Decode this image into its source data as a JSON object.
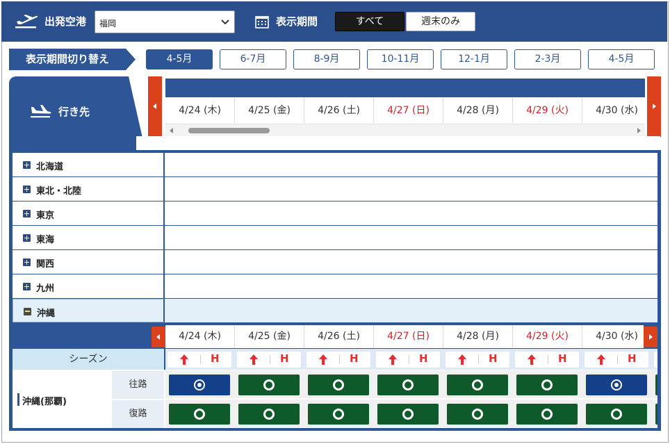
{
  "header": {
    "departure_label": "出発空港",
    "departure_airport": "福岡",
    "display_period_label": "表示期間",
    "filter_all": "すべて",
    "filter_weekend": "週末のみ"
  },
  "period_switch": {
    "label": "表示期間切り替え",
    "options": [
      "4-5月",
      "6-7月",
      "8-9月",
      "10-11月",
      "12-1月",
      "2-3月",
      "4-5月"
    ],
    "active_index": 0
  },
  "destinations_label": "行き先",
  "dates": [
    {
      "label": "4/24 (木)",
      "holiday": false
    },
    {
      "label": "4/25 (金)",
      "holiday": false
    },
    {
      "label": "4/26 (土)",
      "holiday": false
    },
    {
      "label": "4/27 (日)",
      "holiday": true
    },
    {
      "label": "4/28 (月)",
      "holiday": false
    },
    {
      "label": "4/29 (火)",
      "holiday": true
    },
    {
      "label": "4/30 (水)",
      "holiday": false
    }
  ],
  "regions": [
    {
      "name": "北海道",
      "expanded": false
    },
    {
      "name": "東北・北陸",
      "expanded": false
    },
    {
      "name": "東京",
      "expanded": false
    },
    {
      "name": "東海",
      "expanded": false
    },
    {
      "name": "関西",
      "expanded": false
    },
    {
      "name": "九州",
      "expanded": false
    },
    {
      "name": "沖縄",
      "expanded": true
    }
  ],
  "season_label": "シーズン",
  "season_mark": "H",
  "route": {
    "name": "沖縄(那覇)",
    "outbound_label": "往路",
    "return_label": "復路",
    "outbound": [
      "blue",
      "green",
      "green",
      "green",
      "green",
      "green",
      "blue"
    ],
    "return": [
      "green",
      "green",
      "green",
      "green",
      "green",
      "green",
      "green"
    ]
  },
  "colors": {
    "navy": "#2e5596",
    "header": "#2b4f8c",
    "accent_orange": "#d9421a",
    "holiday_red": "#d0202a",
    "slot_green": "#0f5a2a",
    "slot_blue": "#14408a"
  }
}
